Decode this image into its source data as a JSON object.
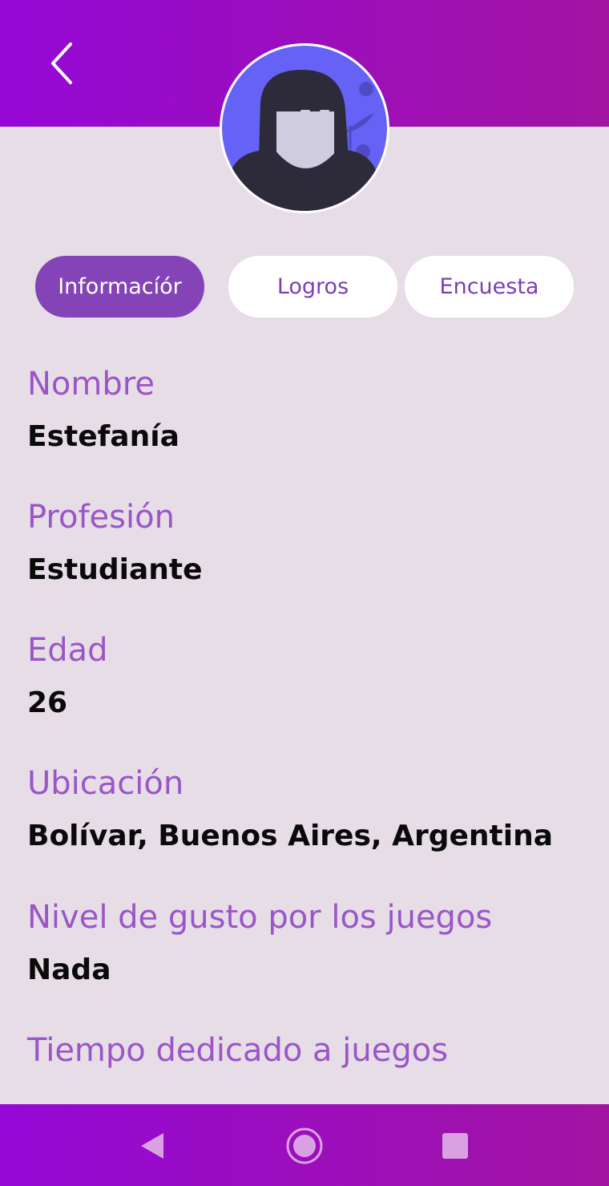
{
  "tabs": [
    {
      "label": "Informacíór"
    },
    {
      "label": "Logros"
    },
    {
      "label": "Encuesta"
    }
  ],
  "fields": [
    {
      "label": "Nombre",
      "value": "Estefanía"
    },
    {
      "label": "Profesión",
      "value": "Estudiante"
    },
    {
      "label": "Edad",
      "value": "26"
    },
    {
      "label": "Ubicación",
      "value": "Bolívar, Buenos Aires, Argentina"
    },
    {
      "label": "Nivel de gusto por los juegos",
      "value": "Nada"
    },
    {
      "label": "Tiempo dedicado a juegos",
      "value": ""
    }
  ],
  "icons": {
    "back": "chevron-left-icon",
    "nav_back": "triangle-back-icon",
    "nav_home": "circle-home-icon",
    "nav_recents": "square-recents-icon"
  },
  "colors": {
    "header_gradient_start": "#9508d6",
    "header_gradient_end": "#a214a2",
    "background": "#e6dde7",
    "accent": "#8444b8",
    "label": "#9a56c7",
    "avatar_bg": "#6562f5"
  }
}
